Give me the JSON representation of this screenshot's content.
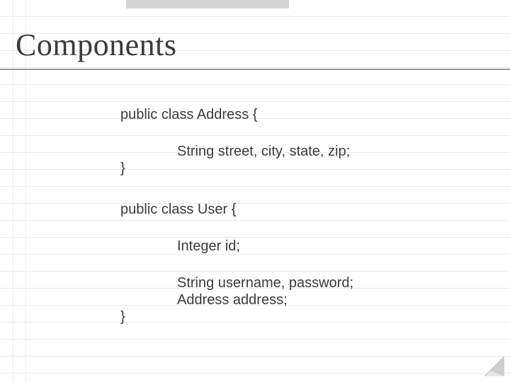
{
  "title": "Components",
  "code": {
    "l1": "public class Address {",
    "l2": "String street, city, state, zip;",
    "l3": "}",
    "l4": "public class User {",
    "l5": "Integer id;",
    "l6": "String username, password;",
    "l7": "Address address;",
    "l8": "}"
  }
}
